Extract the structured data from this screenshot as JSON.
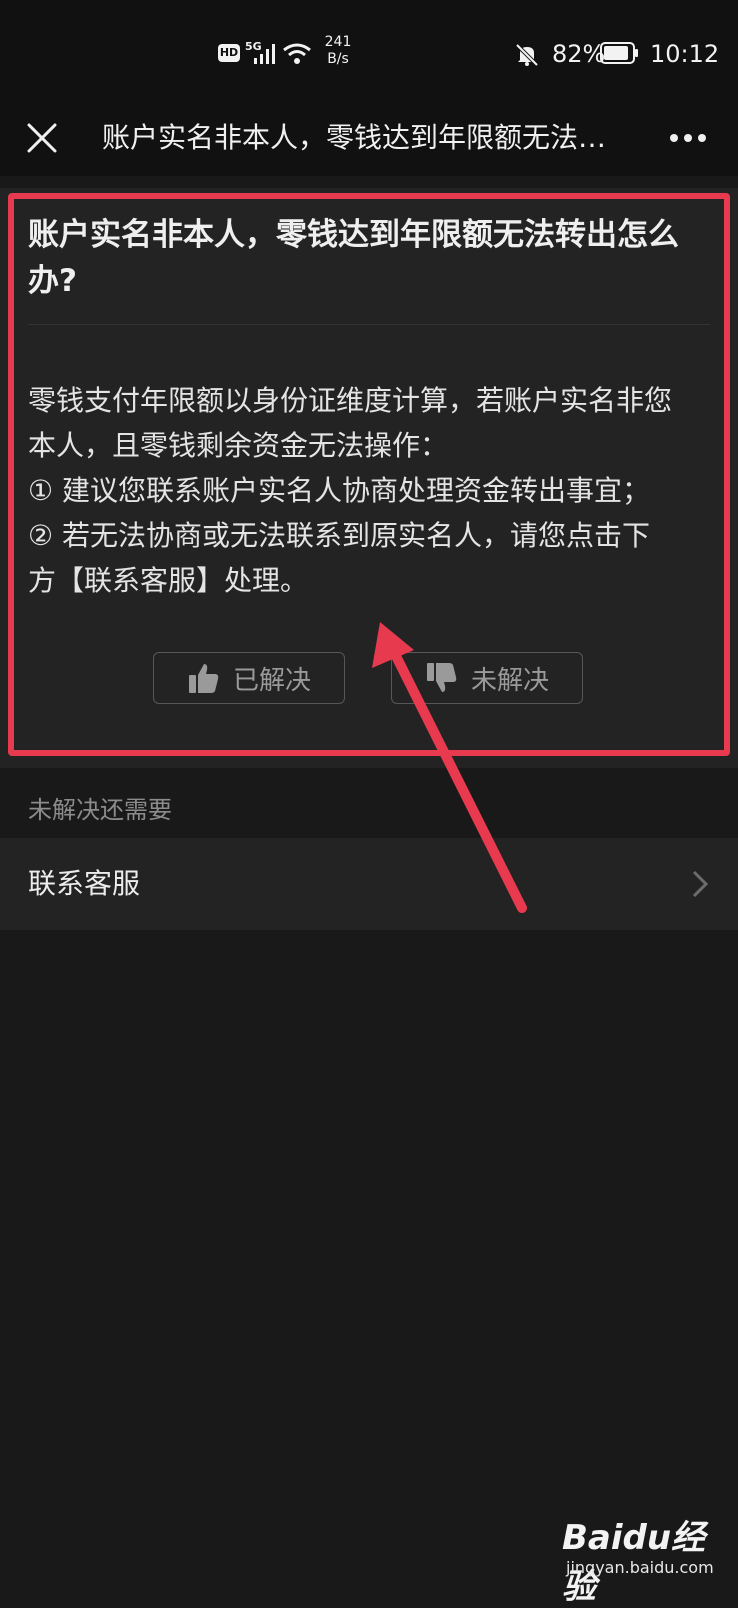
{
  "status_bar": {
    "network_badge": "HD",
    "network_type": "5G",
    "speed_value": "241",
    "speed_unit": "B/s",
    "battery_percent": "82%",
    "time": "10:12"
  },
  "nav": {
    "title": "账户实名非本人，零钱达到年限额无法转出怎么办？",
    "close_icon": "close-icon",
    "more_icon": "more-icon"
  },
  "card": {
    "question": "账户实名非本人，零钱达到年限额无法转出怎么办?",
    "answer_lines": [
      "零钱支付年限额以身份证维度计算，若账户实名非您",
      "本人，且零钱剩余资金无法操作：",
      "① 建议您联系账户实名人协商处理资金转出事宜；",
      "② 若无法协商或无法联系到原实名人，请您点击下",
      "方【联系客服】处理。"
    ],
    "solved_label": "已解决",
    "unsolved_label": "未解决"
  },
  "section": {
    "label": "未解决还需要"
  },
  "contact": {
    "label": "联系客服"
  },
  "annotation": {
    "highlight_color": "#e83a4f"
  },
  "watermark": {
    "brand": "Baidu经验",
    "url": "jingyan.baidu.com"
  }
}
